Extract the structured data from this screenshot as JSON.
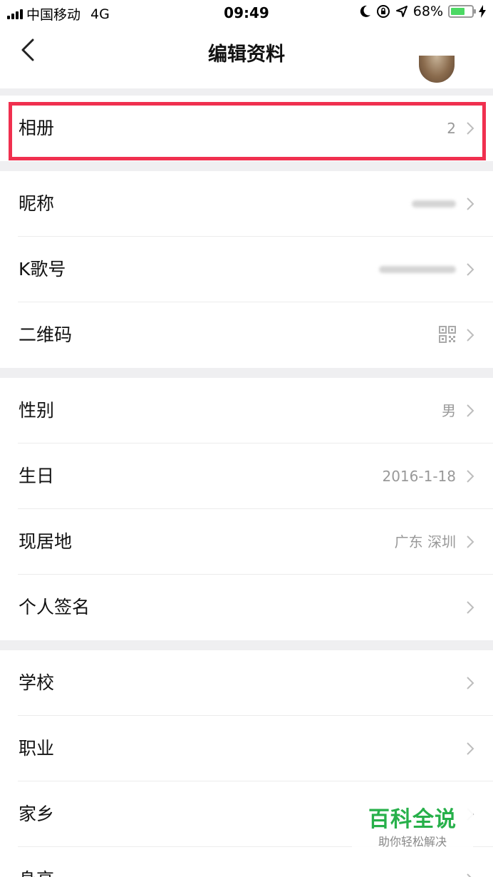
{
  "status_bar": {
    "carrier": "中国移动",
    "network": "4G",
    "time": "09:49",
    "battery": "68%",
    "battery_level": 0.68
  },
  "nav": {
    "title": "编辑资料",
    "back_icon": "chevron-left-icon"
  },
  "sections": [
    {
      "rows": [
        {
          "label": "相册",
          "value": "2"
        }
      ]
    },
    {
      "rows": [
        {
          "label": "昵称",
          "value": ""
        },
        {
          "label": "K歌号",
          "value": ""
        },
        {
          "label": "二维码",
          "value": "",
          "icon": "qrcode-icon"
        }
      ]
    },
    {
      "rows": [
        {
          "label": "性别",
          "value": "男"
        },
        {
          "label": "生日",
          "value": "2016-1-18"
        },
        {
          "label": "现居地",
          "value": "广东 深圳"
        },
        {
          "label": "个人签名",
          "value": ""
        }
      ]
    },
    {
      "rows": [
        {
          "label": "学校",
          "value": ""
        },
        {
          "label": "职业",
          "value": ""
        },
        {
          "label": "家乡",
          "value": ""
        },
        {
          "label": "身高",
          "value": ""
        }
      ]
    }
  ],
  "watermark": {
    "title": "百科全说",
    "subtitle": "助你轻松解决"
  },
  "colors": {
    "highlight": "#f0304f",
    "watermark": "#27b04a",
    "battery": "#4cd964",
    "section_gap": "#efeff1"
  }
}
